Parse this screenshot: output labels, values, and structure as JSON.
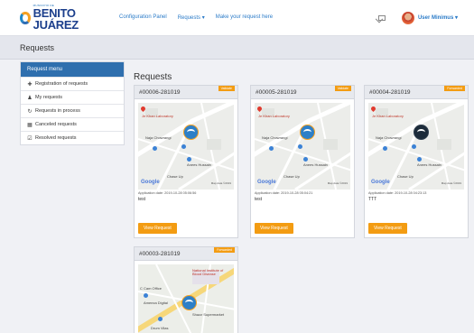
{
  "brand": {
    "small": "MUNICIPIO DE",
    "name": "BENITO JUÁREZ"
  },
  "nav": {
    "links": [
      "Configuration Panel",
      "Requests ▾",
      "Make your request here"
    ],
    "user": "User Minimus ▾"
  },
  "page": {
    "title": "Requests"
  },
  "sidebar": {
    "heading": "Request menu",
    "items": [
      {
        "label": "Registration of requests",
        "icon": "plus-icon"
      },
      {
        "label": "My requests",
        "icon": "user-icon"
      },
      {
        "label": "Requests in process",
        "icon": "refresh-icon"
      },
      {
        "label": "Canceled requests",
        "icon": "ban-icon"
      },
      {
        "label": "Resolved requests",
        "icon": "check-icon"
      }
    ]
  },
  "main": {
    "title": "Requests"
  },
  "map_text": {
    "lab": "Je Khan Laboratory",
    "chowrangi": "Naja Chowrangi",
    "hospital": "Anees Hussain",
    "chase": "Chase Up",
    "google": "Google",
    "map_data": "Map data ©2019"
  },
  "map4_text": {
    "institute": "National Institute of Blood Disease",
    "office": "C Cam Office",
    "digital": "Ameeza Digital",
    "super": "Shazz Supermarket",
    "drum": "Drum Vilas"
  },
  "cards": [
    {
      "id": "#00006-281019",
      "status": "Validate",
      "date": "Application date: 2019-10-28 05:06:56",
      "desc": "test",
      "button": "View Request"
    },
    {
      "id": "#00005-281019",
      "status": "Validate",
      "date": "Application date: 2019-10-28 05:04:21",
      "desc": "test",
      "button": "View Request"
    },
    {
      "id": "#00004-281019",
      "status": "Forwarded",
      "date": "Application date: 2019-10-28 04:23:13",
      "desc": "TTT",
      "button": "View Request"
    },
    {
      "id": "#00003-281019",
      "status": "Forwarded"
    }
  ],
  "colors": {
    "primary": "#2f6fae",
    "accent": "#f39c12",
    "link": "#2b7bc8"
  }
}
